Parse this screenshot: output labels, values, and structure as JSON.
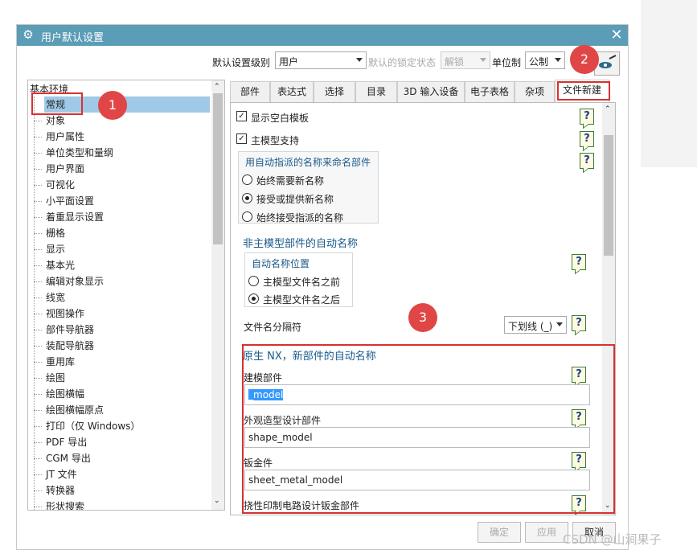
{
  "dialog": {
    "title": "用户默认设置",
    "close": "✕"
  },
  "toolbar": {
    "level_label": "默认设置级别",
    "level_value": "用户",
    "lock_label": "默认的锁定状态",
    "lock_value": "解锁",
    "unit_label": "单位制",
    "unit_value": "公制"
  },
  "tree": {
    "root": "基本环境",
    "items": [
      "常规",
      "对象",
      "用户属性",
      "单位类型和量纲",
      "用户界面",
      "可视化",
      "小平面设置",
      "着重显示设置",
      "栅格",
      "显示",
      "基本光",
      "编辑对象显示",
      "线宽",
      "视图操作",
      "部件导航器",
      "装配导航器",
      "重用库",
      "绘图",
      "绘图横幅",
      "绘图横幅原点",
      "打印（仅 Windows）",
      "PDF 导出",
      "CGM 导出",
      "JT 文件",
      "转换器",
      "形状搜索"
    ],
    "selected_index": 0
  },
  "tabs": [
    "部件",
    "表达式",
    "选择",
    "目录",
    "3D 输入设备",
    "电子表格",
    "杂项",
    "文件新建"
  ],
  "active_tab": 7,
  "content": {
    "show_blank_template": "显示空白模板",
    "master_model_support": "主模型支持",
    "assigned_name_group_title": "用自动指派的名称来命名部件",
    "radio_always_new": "始终需要新名称",
    "radio_accept_or_new": "接受或提供新名称",
    "radio_always_accept": "始终接受指派的名称",
    "non_master_title": "非主模型部件的自动名称",
    "auto_name_position_title": "自动名称位置",
    "radio_before": "主模型文件名之前",
    "radio_after": "主模型文件名之后",
    "separator_label": "文件名分隔符",
    "separator_value": "下划线 (_)",
    "native_title": "原生 NX，新部件的自动名称",
    "modeling_label": "建模部件",
    "modeling_value": "_model",
    "shape_label": "外观造型设计部件",
    "shape_value": "shape_model",
    "sheet_label": "钣金件",
    "sheet_value": "sheet_metal_model",
    "flex_label": "挠性印制电路设计钣金部件",
    "help": "?"
  },
  "badges": [
    "1",
    "2",
    "3"
  ],
  "buttons": {
    "ok": "确定",
    "apply": "应用",
    "cancel": "取消"
  },
  "watermark": "CSDN @山涧果子"
}
